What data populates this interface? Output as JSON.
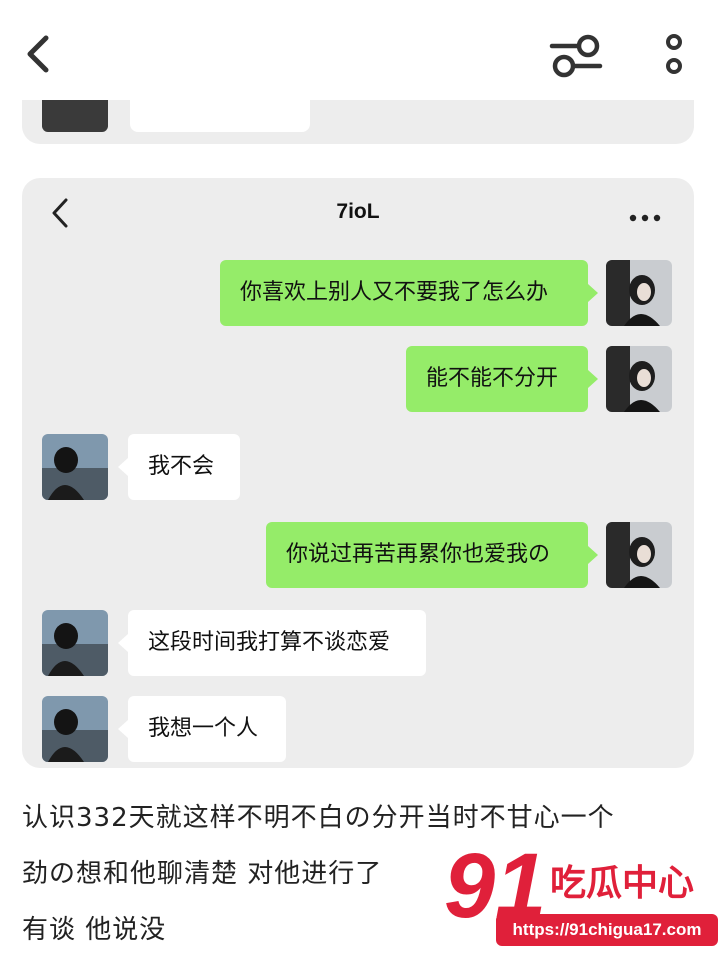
{
  "topbar": {
    "back_icon": "chevron-left-icon",
    "filter_icon": "sliders-icon",
    "more_icon": "vertical-dots-icon"
  },
  "chat": {
    "title": "7ioL",
    "back_icon": "chevron-left-icon",
    "more_icon": "horizontal-dots-icon",
    "messages": [
      {
        "side": "me",
        "text": "你喜欢上别人又不要我了怎么办"
      },
      {
        "side": "me",
        "text": "能不能不分开"
      },
      {
        "side": "them",
        "text": "我不会"
      },
      {
        "side": "me",
        "text": "你说过再苦再累你也爱我の"
      },
      {
        "side": "them",
        "text": "这段时间我打算不谈恋爱"
      },
      {
        "side": "them",
        "text": "我想一个人"
      }
    ],
    "colors": {
      "me_bubble": "#95ec69",
      "them_bubble": "#ffffff",
      "card": "#ededed"
    }
  },
  "article": {
    "lines": [
      "认识332天就这样不明不白の分开当时不甘心一个",
      "劲の想和他聊清楚 对他进行了",
      "有谈 他说没"
    ]
  },
  "watermark": {
    "logo": "91",
    "name": "吃瓜中心",
    "url": "https://91chigua17.com",
    "color": "#e0203a"
  }
}
